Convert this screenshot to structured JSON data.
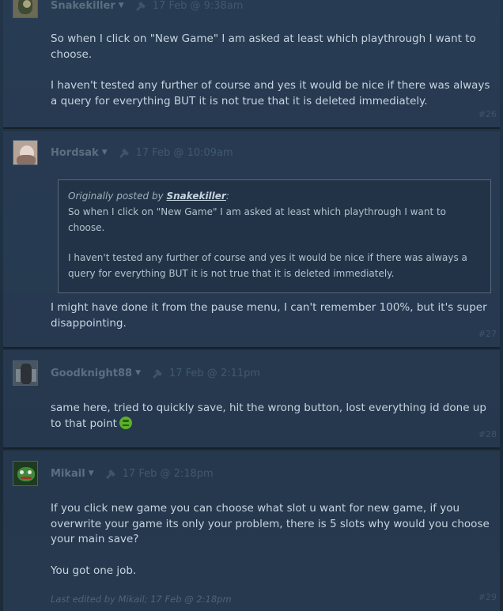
{
  "posts": [
    {
      "author": "Snakekiller",
      "date": "17 Feb @ 9:38am",
      "paragraphs": [
        "So when I click on \"New Game\" I am asked at least which playthrough I want to choose.",
        "I haven't tested any further of course and yes it would be nice if there was always a query for everything BUT it is not true that it is deleted immediately."
      ],
      "number": "#26"
    },
    {
      "author": "Hordsak",
      "date": "17 Feb @ 10:09am",
      "quote": {
        "prefix": "Originally posted by ",
        "author": "Snakekiller",
        "suffix": ":",
        "paragraphs": [
          "So when I click on \"New Game\" I am asked at least which playthrough I want to choose.",
          "I haven't tested any further of course and yes it would be nice if there was always a query for everything BUT it is not true that it is deleted immediately."
        ]
      },
      "paragraphs": [
        "I might have done it from the pause menu, I can't remember 100%, but it's super disappointing."
      ],
      "number": "#27"
    },
    {
      "author": "Goodknight88",
      "date": "17 Feb @ 2:11pm",
      "paragraphs": [
        "same here, tried to quickly save, hit the wrong button, lost everything id done up to that point"
      ],
      "number": "#28"
    },
    {
      "author": "Mikail",
      "date": "17 Feb @ 2:18pm",
      "paragraphs": [
        "If you click new game you can choose what slot u want for new game, if you overwrite your game its only your problem, there is 5 slots why would you choose your main save?",
        "You got one job."
      ],
      "edited": "Last edited by Mikail; 17 Feb @ 2:18pm",
      "number": "#29"
    }
  ],
  "colors": {
    "background": "#1e2a37",
    "post_bg": "#293e56",
    "text": "#c6d4df",
    "muted": "#5b6f80",
    "emoticon": "#5cb128"
  },
  "icons": {
    "author_menu": "caret-down-icon",
    "badge": "pin-icon",
    "emoticon": "green-emoticon"
  }
}
